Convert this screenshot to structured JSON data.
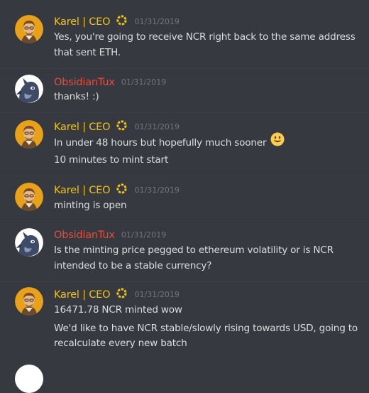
{
  "colors": {
    "background": "#36393f",
    "ceo_name": "#f1c40f",
    "user_name": "#e74c3c",
    "text": "#dcddde",
    "timestamp": "#72767d"
  },
  "messages": [
    {
      "author": "Karel | CEO",
      "timestamp": "01/31/2019",
      "lines": [
        "Yes, you're going to receive NCR right back to the same address",
        "that sent ETH."
      ]
    },
    {
      "author": "ObsidianTux",
      "timestamp": "01/31/2019",
      "lines": [
        "thanks! :)"
      ]
    },
    {
      "author": "Karel | CEO",
      "timestamp": "01/31/2019",
      "lines": [
        "In under 48 hours but hopefully much sooner",
        "10 minutes to mint start"
      ]
    },
    {
      "author": "Karel | CEO",
      "timestamp": "01/31/2019",
      "lines": [
        "minting is open"
      ]
    },
    {
      "author": "ObsidianTux",
      "timestamp": "01/31/2019",
      "lines": [
        "Is the minting price pegged to ethereum volatility or is NCR",
        "intended to be a stable currency?"
      ]
    },
    {
      "author": "Karel | CEO",
      "timestamp": "01/31/2019",
      "lines": [
        "16471.78 NCR minted wow",
        "We'd like to have NCR stable/slowly rising towards USD, going to",
        "recalculate every new batch"
      ]
    }
  ]
}
